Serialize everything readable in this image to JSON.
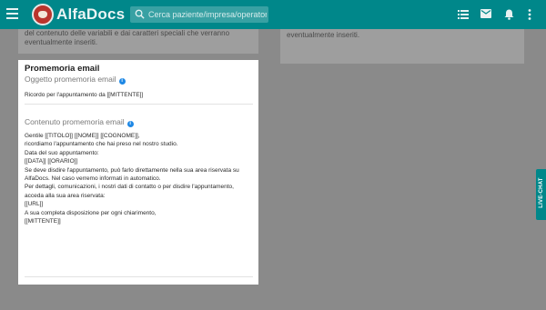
{
  "app": {
    "logo_text": "AlfaDocs"
  },
  "search": {
    "placeholder": "Cerca paziente/impresa/operatore"
  },
  "icons": {
    "menu": "hamburger-menu-icon",
    "search": "search-icon",
    "list": "list-icon",
    "mail": "mail-icon",
    "bell": "bell-icon",
    "more": "more-vertical-icon",
    "info": "info-icon",
    "chat": "chat-icon"
  },
  "colors": {
    "topbar": "#00878a",
    "accent_info": "#1e88e5"
  },
  "background_cards": {
    "left_lines": [
      "del contenuto delle variabili e dai caratteri speciali che verranno",
      "eventualmente inseriti."
    ],
    "right_lines": [
      "eventualmente inseriti."
    ]
  },
  "modal": {
    "title": "Promemoria email",
    "subject_label": "Oggetto promemoria email",
    "subject_value": "Ricordo per l'appuntamento da [[MITTENTE]]",
    "content_label": "Contenuto promemoria email",
    "content_lines": [
      "Gentile [[TITOLO]] [[NOME]] [[COGNOME]],",
      "",
      "ricordiamo l'appuntamento che hai preso nel nostro studio.",
      "",
      "Data del suo appuntamento:",
      "[[DATA]] [[ORARIO]]",
      "",
      "Se deve disdire l'appuntamento, può farlo direttamente nella sua area riservata su",
      "AlfaDocs. Nel caso verremo informati in automatico.",
      "",
      "Per dettagli, comunicazioni, i nostri dati di contatto o per disdire l'appuntamento,",
      "acceda alla sua area riservata:",
      "[[URL]]",
      "",
      "A sua completa disposizione per ogni chiarimento,",
      "",
      "[[MITTENTE]]"
    ]
  },
  "livechat": {
    "label": "LIVE-CHAT"
  }
}
